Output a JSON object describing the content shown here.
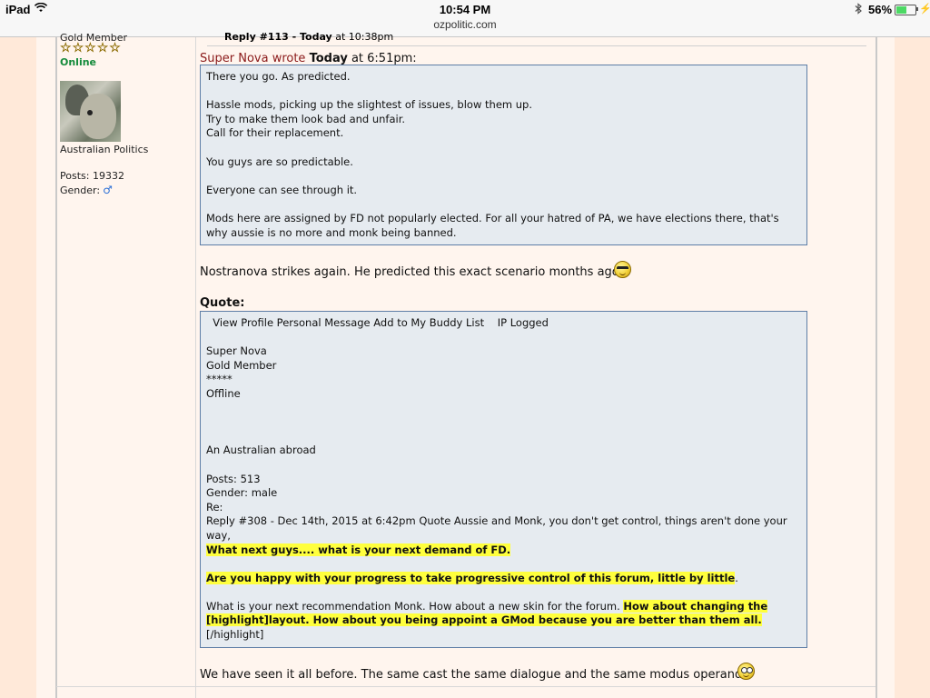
{
  "status_bar": {
    "device": "iPad",
    "time": "10:54 PM",
    "url": "ozpolitic.com",
    "battery": "56%",
    "battery_level": 0.56
  },
  "user": {
    "rank": "Gold Member",
    "stars": [
      "☆",
      "☆",
      "☆",
      "☆",
      "☆"
    ],
    "status": "Online",
    "location": "Australian Politics",
    "posts": "Posts: 19332",
    "gender_label": "Gender:",
    "gender_icon": "male-symbol-icon"
  },
  "post": {
    "reply_header_bold": "Reply #113 - Today",
    "reply_header_rest": " at 10:38pm",
    "quote1_author": "Super Nova wrote",
    "quote1_today": "Today",
    "quote1_time": " at 6:51pm:",
    "quote1_lines": [
      "There you go. As predicted.",
      "",
      "Hassle mods, picking up the slightest of issues, blow them up.",
      "Try to make them look bad and unfair.",
      "Call for their replacement.",
      "",
      "You guys are so predictable.",
      "",
      "Everyone can see through it.",
      "",
      "Mods here are assigned by FD not popularly elected. For all your hatred of PA, we have elections there, that's",
      "why aussie is no more and monk being banned."
    ],
    "body1": "Nostranova strikes again. He predicted this exact scenario months ago.",
    "quote_label": "Quote:",
    "quote2": {
      "line_profile": "  View Profile Personal Message Add to My Buddy List    IP Logged",
      "name": "Super Nova",
      "rank": "Gold Member",
      "stars": "*****",
      "status": "Offline",
      "location": "An Australian abroad",
      "posts": "Posts: 513",
      "gender": "Gender: male",
      "re": "Re:",
      "reply_line1": "Reply #308 - Dec 14th, 2015 at 6:42pm Quote  Aussie and Monk, you don't get control, things aren't done your",
      "reply_line2": "way,",
      "hl1": "What next guys.... what is your next demand of FD.",
      "hl2": "Are you happy with your progress to take progressive control of this forum, little by little",
      "hl2_tail": ".",
      "rec_plain": "What is your next recommendation Monk. How about a new skin for the forum. ",
      "rec_hl1": "How about changing the",
      "rec_hl2": "[highlight]layout. How about you being appoint a GMod because you are better than them all.",
      "rec_end": "[/highlight]"
    },
    "body2": "We have seen it all before. The same cast the same dialogue and the same modus operandi."
  }
}
